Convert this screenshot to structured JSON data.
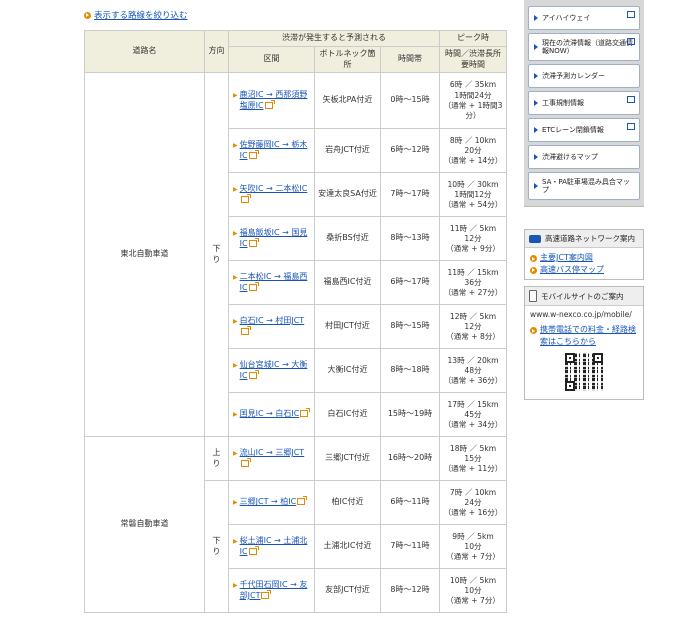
{
  "top_link": "表示する路線を絞り込む",
  "table": {
    "headers": {
      "road": "道路名",
      "direction": "方向",
      "group": "渋滞が発生すると予測される",
      "peak_group": "ピーク時",
      "section": "区間",
      "bottleneck": "ボトルネック箇所",
      "time": "時間帯",
      "peak": "時間／渋滞長所要時間"
    },
    "roads": [
      {
        "name": "東北自動車道",
        "groups": [
          {
            "direction": "下り",
            "rows": [
              {
                "section": "鹿沼IC → 西那須野塩原IC",
                "bottleneck": "矢板北PA付近",
                "time": "0時～15時",
                "peak": [
                  "6時 ／ 35km",
                  "1時間24分",
                  "（通常 + 1時間3分）"
                ]
              },
              {
                "section": "佐野藤岡IC → 栃木IC",
                "bottleneck": "岩舟JCT付近",
                "time": "6時～12時",
                "peak": [
                  "8時 ／ 10km",
                  "20分",
                  "（通常 + 14分）"
                ]
              },
              {
                "section": "矢吹IC → 二本松IC",
                "bottleneck": "安達太良SA付近",
                "time": "7時～17時",
                "peak": [
                  "10時 ／ 30km",
                  "1時間12分",
                  "（通常 + 54分）"
                ]
              },
              {
                "section": "福島飯坂IC → 国見IC",
                "bottleneck": "桑折BS付近",
                "time": "8時～13時",
                "peak": [
                  "11時 ／ 5km",
                  "12分",
                  "（通常 + 9分）"
                ]
              },
              {
                "section": "二本松IC → 福島西IC",
                "bottleneck": "福島西IC付近",
                "time": "6時～17時",
                "peak": [
                  "11時 ／ 15km",
                  "36分",
                  "（通常 + 27分）"
                ]
              },
              {
                "section": "白石IC → 村田JCT",
                "bottleneck": "村田JCT付近",
                "time": "8時～15時",
                "peak": [
                  "12時 ／ 5km",
                  "12分",
                  "（通常 + 8分）"
                ]
              },
              {
                "section": "仙台宮城IC → 大衡IC",
                "bottleneck": "大衡IC付近",
                "time": "8時～18時",
                "peak": [
                  "13時 ／ 20km",
                  "48分",
                  "（通常 + 36分）"
                ]
              },
              {
                "section": "国見IC → 白石IC",
                "bottleneck": "白石IC付近",
                "time": "15時～19時",
                "peak": [
                  "17時 ／ 15km",
                  "45分",
                  "（通常 + 34分）"
                ]
              }
            ]
          }
        ]
      },
      {
        "name": "常磐自動車道",
        "groups": [
          {
            "direction": "上り",
            "rows": [
              {
                "section": "流山IC → 三郷JCT",
                "bottleneck": "三郷JCT付近",
                "time": "16時～20時",
                "peak": [
                  "18時 ／ 5km",
                  "15分",
                  "（通常 + 11分）"
                ]
              }
            ]
          },
          {
            "direction": "下り",
            "rows": [
              {
                "section": "三郷JCT → 柏IC",
                "bottleneck": "柏IC付近",
                "time": "6時～11時",
                "peak": [
                  "7時 ／ 10km",
                  "24分",
                  "（通常 + 16分）"
                ]
              },
              {
                "section": "桜土浦IC → 土浦北IC",
                "bottleneck": "土浦北IC付近",
                "time": "7時～11時",
                "peak": [
                  "9時 ／ 5km",
                  "10分",
                  "（通常 + 7分）"
                ]
              },
              {
                "section": "千代田石岡IC → 友部JCT",
                "bottleneck": "友部JCT付近",
                "time": "8時～12時",
                "peak": [
                  "10時 ／ 5km",
                  "10分",
                  "（通常 + 7分）"
                ]
              }
            ]
          }
        ]
      }
    ]
  },
  "sidebar": {
    "buttons": [
      {
        "label": "アイハイウェイ",
        "external": true
      },
      {
        "label": "現在の渋滞情報（道路交通情報NOW）",
        "external": true
      },
      {
        "label": "渋滞予測カレンダー",
        "external": false
      },
      {
        "label": "工事規制情報",
        "external": true
      },
      {
        "label": "ETCレーン閉鎖情報",
        "external": true
      },
      {
        "label": "渋滞避けるマップ",
        "external": false
      },
      {
        "label": "SA・PA駐車場混み具合マップ",
        "external": false
      }
    ],
    "network": {
      "title": "高速道路ネットワーク案内",
      "links": [
        "主要JCT案内図",
        "高速バス停マップ"
      ]
    },
    "mobile": {
      "title": "モバイルサイトのご案内",
      "url": "www.w-nexco.co.jp/mobile/",
      "link": "携帯電話での料金・経路検索はこちらから"
    }
  }
}
